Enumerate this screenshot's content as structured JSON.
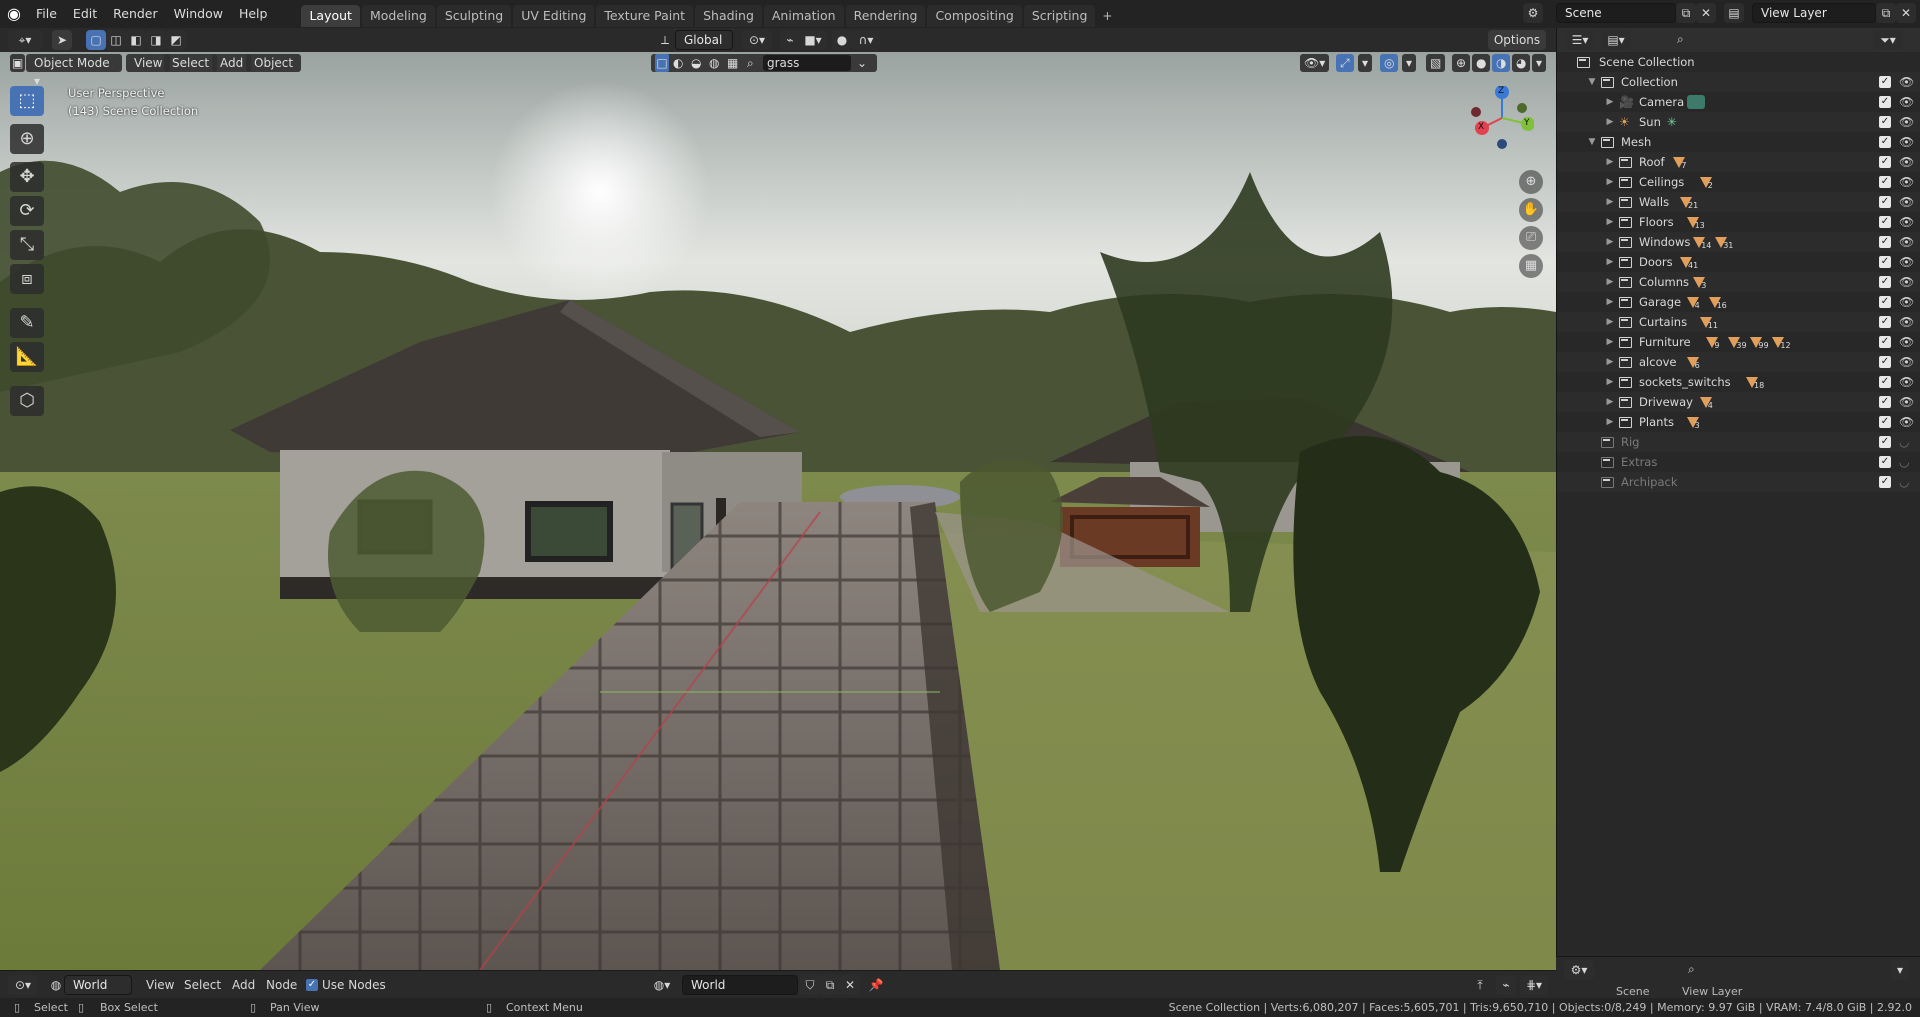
{
  "app": {
    "logo": "blender-logo-icon"
  },
  "menus": [
    "File",
    "Edit",
    "Render",
    "Window",
    "Help"
  ],
  "workspaces": [
    "Layout",
    "Modeling",
    "Sculpting",
    "UV Editing",
    "Texture Paint",
    "Shading",
    "Animation",
    "Rendering",
    "Compositing",
    "Scripting"
  ],
  "active_workspace": "Layout",
  "scene": {
    "name": "Scene",
    "view_layer": "View Layer"
  },
  "header": {
    "transform_orientation": "Global",
    "options_label": "Options",
    "search_value": "grass",
    "mode": "Object Mode",
    "view": "View",
    "select": "Select",
    "add": "Add",
    "object": "Object"
  },
  "viewport": {
    "perspective_label": "User Perspective",
    "collection_label": "(143) Scene Collection",
    "gizmo_axes": [
      "Z",
      "X",
      "Y"
    ]
  },
  "outliner": {
    "root": "Scene Collection",
    "items": [
      {
        "label": "Collection",
        "depth": 0,
        "expanded": true,
        "kind": "collection"
      },
      {
        "label": "Camera",
        "depth": 1,
        "kind": "camera"
      },
      {
        "label": "Sun",
        "depth": 1,
        "kind": "light"
      },
      {
        "label": "Mesh",
        "depth": 0,
        "expanded": true,
        "kind": "collection"
      },
      {
        "label": "Roof",
        "depth": 1,
        "kind": "collection",
        "counts": [
          "7"
        ]
      },
      {
        "label": "Ceilings",
        "depth": 1,
        "kind": "collection",
        "counts": [
          "2"
        ]
      },
      {
        "label": "Walls",
        "depth": 1,
        "kind": "collection",
        "counts": [
          "21"
        ]
      },
      {
        "label": "Floors",
        "depth": 1,
        "kind": "collection",
        "counts": [
          "13"
        ]
      },
      {
        "label": "Windows",
        "depth": 1,
        "kind": "collection",
        "counts": [
          "14",
          "31"
        ]
      },
      {
        "label": "Doors",
        "depth": 1,
        "kind": "collection",
        "counts": [
          "41"
        ]
      },
      {
        "label": "Columns",
        "depth": 1,
        "kind": "collection",
        "counts": [
          "3"
        ]
      },
      {
        "label": "Garage",
        "depth": 1,
        "kind": "collection",
        "counts": [
          "4",
          "16"
        ]
      },
      {
        "label": "Curtains",
        "depth": 1,
        "kind": "collection",
        "counts": [
          "11"
        ]
      },
      {
        "label": "Furniture",
        "depth": 1,
        "kind": "collection",
        "counts": [
          "9",
          "39",
          "99",
          "12"
        ]
      },
      {
        "label": "alcove",
        "depth": 1,
        "kind": "collection",
        "counts": [
          "6"
        ]
      },
      {
        "label": "sockets_switchs",
        "depth": 1,
        "kind": "collection",
        "counts": [
          "18"
        ]
      },
      {
        "label": "Driveway",
        "depth": 1,
        "kind": "collection",
        "counts": [
          "4"
        ]
      },
      {
        "label": "Plants",
        "depth": 1,
        "kind": "collection",
        "counts": [
          "3"
        ]
      },
      {
        "label": "Rig",
        "depth": 0,
        "kind": "collection",
        "dim": true
      },
      {
        "label": "Extras",
        "depth": 0,
        "kind": "collection",
        "dim": true
      },
      {
        "label": "Archipack",
        "depth": 0,
        "kind": "collection",
        "dim": true
      }
    ]
  },
  "properties_panel": {
    "tabs": [
      "Scene",
      "View Layer"
    ]
  },
  "bottom_editor": {
    "type": "World",
    "view": "View",
    "select": "Select",
    "add": "Add",
    "node": "Node",
    "use_nodes_label": "Use Nodes",
    "use_nodes": true,
    "world_name": "World"
  },
  "statusbar": {
    "select": "Select",
    "box_select": "Box Select",
    "pan_view": "Pan View",
    "context_menu": "Context Menu",
    "stats": "Scene Collection | Verts:6,080,207 | Faces:5,605,701 | Tris:9,650,710 | Objects:0/8,249 | Memory: 9.97 GiB | VRAM: 7.4/8.0 GiB | 2.92.0"
  },
  "colors": {
    "accent": "#4772b3",
    "mesh_icon": "#e29f5c",
    "light_icon": "#6fd29b"
  }
}
